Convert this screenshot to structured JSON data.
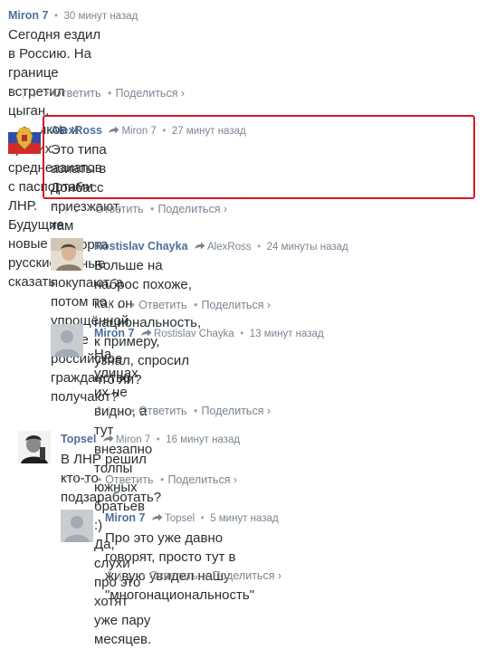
{
  "common": {
    "reply_label": "Ответить",
    "share_label": "Поделиться ›",
    "separator": "•",
    "vote_up": "⌃",
    "vote_down": "⌄",
    "vote_divider": "|",
    "bullet": "•"
  },
  "highlight_color": "#d11d24",
  "comments": [
    {
      "author": "Miron 7",
      "reply_to": "",
      "time": "30 минут назад",
      "lines": [
        "Сегодня ездил в Россию. На границе встретил цыган, таджиков и прочих",
        "среднеазиатов с паспортами ЛНР.",
        "Будущие новые русские, так сказать"
      ],
      "avatar": "none"
    },
    {
      "author": "AlexRoss",
      "reply_to": "Miron 7",
      "time": "27 минут назад",
      "lines": [
        "Это типа азиаты в Донбасс приезжают, там паспорта местные",
        "покупают, а потом по упрощённой схеме российское гражданство",
        "получают?"
      ],
      "avatar": "coat-of-arms",
      "highlighted": true
    },
    {
      "author": "Rostislav Chayka",
      "reply_to": "AlexRoss",
      "time": "24 минуты назад",
      "lines": [
        "Больше на наброс похоже, как он национальность, к примеру,",
        "узнал, спросил что ли?"
      ],
      "avatar": "photo"
    },
    {
      "author": "Miron 7",
      "reply_to": "Rostislav Chayka",
      "time": "13 минут назад",
      "lines": [
        "На улицах их не видно, а тут внезапно толпы южных",
        "братьев :)",
        "Да, слухи про это хотят уже пару месяцев."
      ],
      "avatar": "default"
    },
    {
      "author": "Topsel",
      "reply_to": "Miron 7",
      "time": "16 минут назад",
      "lines": [
        "В ЛНР решил кто-то подзаработать?"
      ],
      "avatar": "photo-bw"
    },
    {
      "author": "Miron 7",
      "reply_to": "Topsel",
      "time": "5 минут назад",
      "lines": [
        "Про это уже давно говорят, просто тут в живую увидел нашу",
        "\"многонациональность\""
      ],
      "avatar": "default"
    }
  ]
}
